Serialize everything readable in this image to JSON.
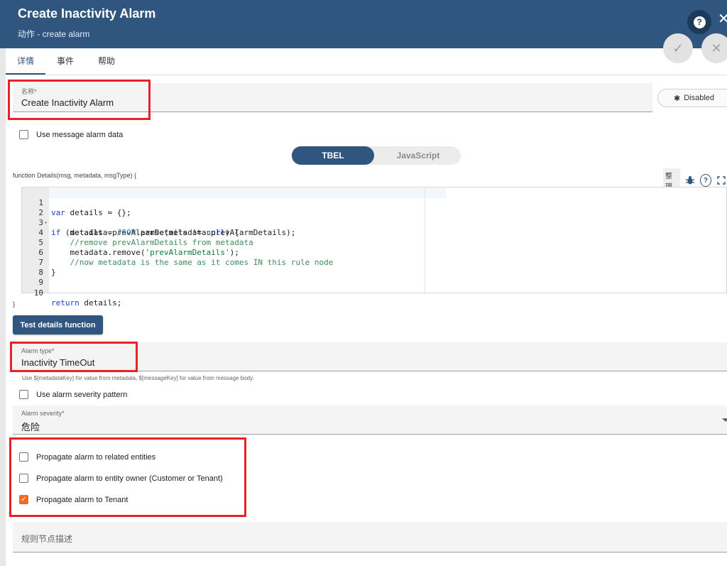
{
  "header": {
    "title": "Create Inactivity Alarm",
    "subtitle": "动作 - create alarm",
    "help_glyph": "?",
    "close_glyph": "✕",
    "accent_color": "#305680"
  },
  "actions": {
    "apply_glyph": "✓",
    "cancel_glyph": "✕"
  },
  "tabs": [
    {
      "label": "详情",
      "active": true
    },
    {
      "label": "事件",
      "active": false
    },
    {
      "label": "帮助",
      "active": false
    }
  ],
  "name_field": {
    "label": "名称*",
    "value": "Create Inactivity Alarm"
  },
  "debug_button": {
    "label": "Disabled",
    "icon": "bug-icon"
  },
  "use_message_alarm_data": {
    "label": "Use message alarm data",
    "checked": false
  },
  "script_lang": {
    "options": [
      "TBEL",
      "JavaScript"
    ],
    "selected": "TBEL"
  },
  "editor": {
    "signature": "function Details(msg, metadata, msgType) {",
    "closing": "}",
    "toolbar": {
      "tidy_label": "整理",
      "debug_icon": "bug-icon",
      "help_glyph": "?",
      "fullscreen_icon": "fullscreen-icon"
    },
    "line_numbers": [
      "1",
      "2",
      "3",
      "4",
      "5",
      "6",
      "7",
      "8",
      "9",
      "10"
    ],
    "fold_marker": "▾"
  },
  "test_button": {
    "label": "Test details function"
  },
  "alarm_type": {
    "label": "Alarm type*",
    "value": "Inactivity TimeOut",
    "hint": "Use ${metadataKey} for value from metadata, $[messageKey] for value from message body."
  },
  "use_severity_pattern": {
    "label": "Use alarm severity pattern",
    "checked": false
  },
  "alarm_severity": {
    "label": "Alarm severity*",
    "value": "危险"
  },
  "propagation": [
    {
      "label": "Propagate alarm to related entities",
      "checked": false
    },
    {
      "label": "Propagate alarm to entity owner (Customer or Tenant)",
      "checked": false
    },
    {
      "label": "Propagate alarm to Tenant",
      "checked": true,
      "check_glyph": "✓"
    }
  ],
  "description": {
    "placeholder": "规则节点描述"
  },
  "highlight_color": "#e8222b",
  "checkbox_checked_color": "#f26b1f"
}
